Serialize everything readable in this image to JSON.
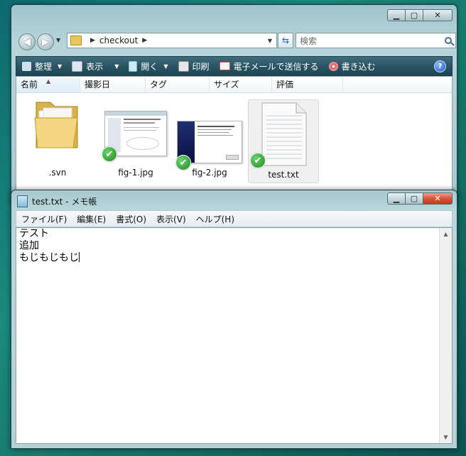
{
  "explorer": {
    "address": {
      "path_segment": "checkout"
    },
    "search_placeholder": "検索",
    "toolbar": [
      {
        "label": "整理",
        "icon": "organize-icon",
        "dropdown": true
      },
      {
        "label": "表示",
        "icon": "views-icon",
        "dropdown": true
      },
      {
        "label": "開く",
        "icon": "open-icon",
        "dropdown": true
      },
      {
        "label": "印刷",
        "icon": "print-icon",
        "dropdown": false
      },
      {
        "label": "電子メールで送信する",
        "icon": "email-icon",
        "dropdown": false
      },
      {
        "label": "書き込む",
        "icon": "burn-icon",
        "dropdown": false
      }
    ],
    "columns": [
      "名前",
      "撮影日",
      "タグ",
      "サイズ",
      "評価"
    ],
    "files": [
      {
        "name": ".svn",
        "type": "folder",
        "overlay": false,
        "selected": false
      },
      {
        "name": "fig-1.jpg",
        "type": "image",
        "overlay": true,
        "selected": false
      },
      {
        "name": "fig-2.jpg",
        "type": "image",
        "overlay": true,
        "selected": false
      },
      {
        "name": "test.txt",
        "type": "text",
        "overlay": true,
        "selected": true
      }
    ]
  },
  "notepad": {
    "title": "test.txt - メモ帳",
    "menu": [
      "ファイル(F)",
      "編集(E)",
      "書式(O)",
      "表示(V)",
      "ヘルプ(H)"
    ],
    "lines": [
      "テスト",
      "追加",
      "もじもじもじ"
    ]
  },
  "colors": {
    "toolbar_bg": "#2b5565",
    "check_overlay": "#1c8c22",
    "desktop": "#157566"
  }
}
